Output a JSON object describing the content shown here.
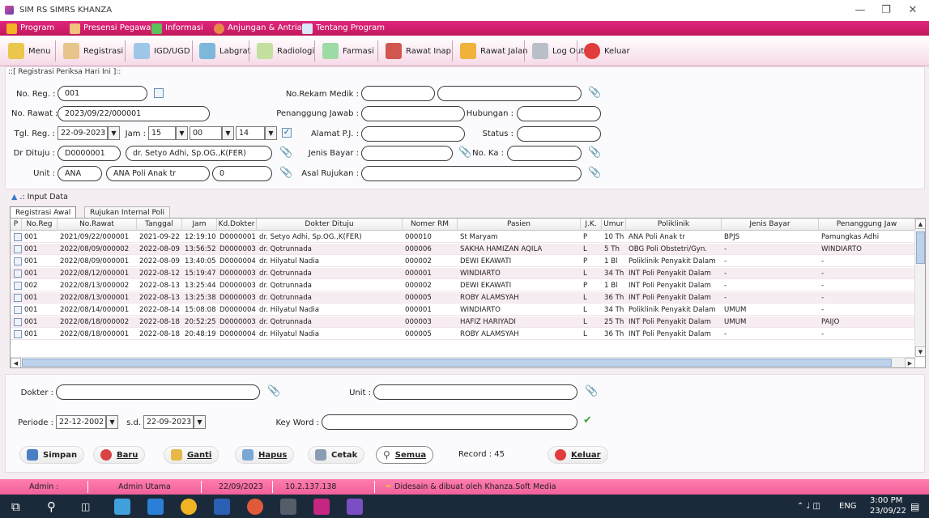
{
  "window": {
    "title": "SIM RS SIMRS KHANZA"
  },
  "menubar": {
    "items": [
      "Program",
      "Presensi Pegawai",
      "Informasi",
      "Anjungan & Antrian",
      "Tentang Program"
    ]
  },
  "toolbar": {
    "items": [
      "Menu",
      "Registrasi",
      "IGD/UGD",
      "Labgrat",
      "Radiologi",
      "Farmasi",
      "Rawat Inap",
      "Rawat Jalan",
      "Log Out",
      "Keluar"
    ]
  },
  "form": {
    "panel_title": "::[ Registrasi Periksa Hari Ini ]::",
    "no_reg_label": "No. Reg. :",
    "no_reg": "001",
    "no_rawat_label": "No. Rawat :",
    "no_rawat": "2023/09/22/000001",
    "tgl_reg_label": "Tgl. Reg. :",
    "tgl_reg": "22-09-2023",
    "jam_label": "Jam :",
    "jam_h": "15",
    "jam_m": "00",
    "jam_s": "14",
    "dr_dituju_label": "Dr Dituju :",
    "dr_kode": "D0000001",
    "dr_nama": "dr. Setyo Adhi, Sp.OG.,K(FER)",
    "unit_label": "Unit :",
    "unit_kode": "ANA",
    "unit_nama": "ANA Poli Anak tr",
    "unit_biaya": "0",
    "no_rm_label": "No.Rekam Medik :",
    "no_rm": "",
    "nama_pasien": "",
    "pj_label": "Penanggung Jawab :",
    "pj": "",
    "hubungan_label": "Hubungan :",
    "hubungan": "",
    "alamat_pj_label": "Alamat P.J. :",
    "alamat_pj": "",
    "status_label": "Status :",
    "status": "",
    "jenis_bayar_label": "Jenis Bayar :",
    "jenis_bayar": "",
    "no_ka_label": "No. Ka :",
    "no_ka": "",
    "asal_rujukan_label": "Asal Rujukan :",
    "asal_rujukan": ""
  },
  "input_data_label": ".: Input Data",
  "tabs": [
    "Registrasi Awal",
    "Rujukan Internal Poli"
  ],
  "grid": {
    "columns": [
      "P",
      "No.Reg",
      "No.Rawat",
      "Tanggal",
      "Jam",
      "Kd.Dokter",
      "Dokter Dituju",
      "Nomer RM",
      "Pasien",
      "J.K.",
      "Umur",
      "Poliklinik",
      "Jenis Bayar",
      "Penanggung Jaw"
    ],
    "rows": [
      [
        "001",
        "2021/09/22/000001",
        "2021-09-22",
        "12:19:10",
        "D0000001",
        "dr. Setyo Adhi, Sp.OG.,K(FER)",
        "000010",
        "St Maryam",
        "P",
        "10 Th",
        "ANA Poli Anak tr",
        "BPJS",
        "Pamungkas Adhi"
      ],
      [
        "001",
        "2022/08/09/000002",
        "2022-08-09",
        "13:56:52",
        "D0000003",
        "dr. Qotrunnada",
        "000006",
        "SAKHA HAMIZAN AQILA",
        "L",
        "5 Th",
        "OBG Poli Obstetri/Gyn.",
        "-",
        "WINDIARTO"
      ],
      [
        "001",
        "2022/08/09/000001",
        "2022-08-09",
        "13:40:05",
        "D0000004",
        "dr. Hilyatul Nadia",
        "000002",
        "DEWI EKAWATI",
        "P",
        "1 Bl",
        "Poliklinik Penyakit Dalam",
        "-",
        "-"
      ],
      [
        "001",
        "2022/08/12/000001",
        "2022-08-12",
        "15:19:47",
        "D0000003",
        "dr. Qotrunnada",
        "000001",
        "WINDIARTO",
        "L",
        "34 Th",
        "INT Poli Penyakit Dalam",
        "-",
        "-"
      ],
      [
        "002",
        "2022/08/13/000002",
        "2022-08-13",
        "13:25:44",
        "D0000003",
        "dr. Qotrunnada",
        "000002",
        "DEWI EKAWATI",
        "P",
        "1 Bl",
        "INT Poli Penyakit Dalam",
        "-",
        "-"
      ],
      [
        "001",
        "2022/08/13/000001",
        "2022-08-13",
        "13:25:38",
        "D0000003",
        "dr. Qotrunnada",
        "000005",
        "ROBY ALAMSYAH",
        "L",
        "36 Th",
        "INT Poli Penyakit Dalam",
        "-",
        "-"
      ],
      [
        "001",
        "2022/08/14/000001",
        "2022-08-14",
        "15:08:08",
        "D0000004",
        "dr. Hilyatul Nadia",
        "000001",
        "WINDIARTO",
        "L",
        "34 Th",
        "Poliklinik Penyakit Dalam",
        "UMUM",
        "-"
      ],
      [
        "001",
        "2022/08/18/000002",
        "2022-08-18",
        "20:52:25",
        "D0000003",
        "dr. Qotrunnada",
        "000003",
        "HAFIZ HARIYADI",
        "L",
        "25 Th",
        "INT Poli Penyakit Dalam",
        "UMUM",
        "PAIJO"
      ],
      [
        "001",
        "2022/08/18/000001",
        "2022-08-18",
        "20:48:19",
        "D0000004",
        "dr. Hilyatul Nadia",
        "000005",
        "ROBY ALAMSYAH",
        "L",
        "36 Th",
        "INT Poli Penyakit Dalam",
        "-",
        "-"
      ]
    ]
  },
  "filter": {
    "dokter_label": "Dokter :",
    "dokter": "",
    "unit_label": "Unit :",
    "unit": "",
    "periode_label": "Periode :",
    "periode_dari": "22-12-2002",
    "sd_label": "s.d.",
    "periode_sampai": "22-09-2023",
    "keyword_label": "Key Word :",
    "keyword": ""
  },
  "buttons": {
    "simpan": "Simpan",
    "baru": "Baru",
    "ganti": "Ganti",
    "hapus": "Hapus",
    "cetak": "Cetak",
    "semua": "Semua",
    "record": "Record : 45",
    "keluar": "Keluar"
  },
  "statusbar": {
    "user_label": "Admin :",
    "user": "Admin Utama",
    "date": "22/09/2023",
    "ip": "10.2.137.138",
    "credit": "Didesain & dibuat oleh Khanza.Soft Media"
  },
  "taskbar": {
    "lang": "ENG",
    "time": "3:00 PM",
    "date": "23/09/22"
  },
  "colors": {
    "menubar": "#d81b6a",
    "statusbar": "#f4679f",
    "row_alt": "#f7ecf1",
    "taskbar": "#1b2a3a"
  }
}
